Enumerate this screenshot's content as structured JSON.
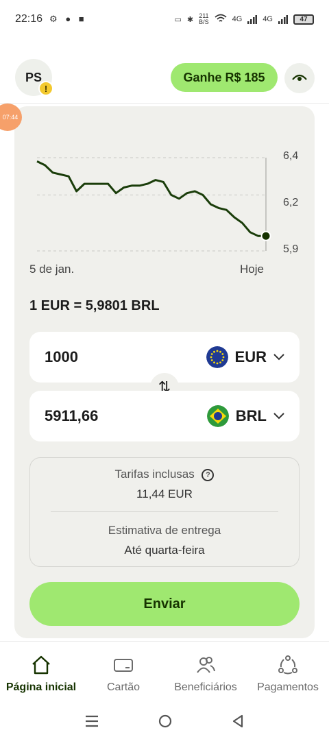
{
  "status_bar": {
    "time": "22:16",
    "net_speed_value": "211",
    "net_speed_unit": "B/S",
    "sim1": "4G",
    "sim2": "4G",
    "battery": "47"
  },
  "header": {
    "avatar_initials": "PS",
    "avatar_badge": "!",
    "reward_label": "Ganhe R$ 185",
    "timer_bubble": "07:44"
  },
  "chart_data": {
    "type": "line",
    "x_labels": [
      "5 de jan.",
      "Hoje"
    ],
    "y_ticks": [
      "6,4",
      "6,2",
      "5,9"
    ],
    "ylim": [
      5.9,
      6.4
    ],
    "grid": true,
    "series": [
      {
        "values": [
          6.38,
          6.36,
          6.32,
          6.31,
          6.3,
          6.22,
          6.26,
          6.26,
          6.26,
          6.26,
          6.21,
          6.24,
          6.25,
          6.25,
          6.26,
          6.28,
          6.27,
          6.2,
          6.18,
          6.21,
          6.22,
          6.2,
          6.15,
          6.13,
          6.12,
          6.08,
          6.05,
          6.0,
          5.98,
          5.98
        ]
      }
    ],
    "colors": {
      "line": "#1a3d0a",
      "grid": "#c8c8c4",
      "endpoint": "#163300"
    }
  },
  "converter": {
    "rate_text": "1 EUR = 5,9801 BRL",
    "send_amount": "1000",
    "send_currency": "EUR",
    "receive_amount": "5911,66",
    "receive_currency": "BRL",
    "swap_icon": "⇅"
  },
  "info": {
    "fees_label": "Tarifas inclusas",
    "fees_value": "11,44 EUR",
    "delivery_label": "Estimativa de entrega",
    "delivery_value": "Até quarta-feira"
  },
  "send_button": "Enviar",
  "bottom_nav": {
    "items": [
      {
        "label": "Página inicial",
        "icon": "home-icon"
      },
      {
        "label": "Cartão",
        "icon": "card-icon"
      },
      {
        "label": "Beneficiários",
        "icon": "recipients-icon"
      },
      {
        "label": "Pagamentos",
        "icon": "payments-icon"
      }
    ]
  },
  "colors": {
    "accent": "#9fe870",
    "accent_text": "#163300",
    "card_bg": "#f0f0ec"
  }
}
